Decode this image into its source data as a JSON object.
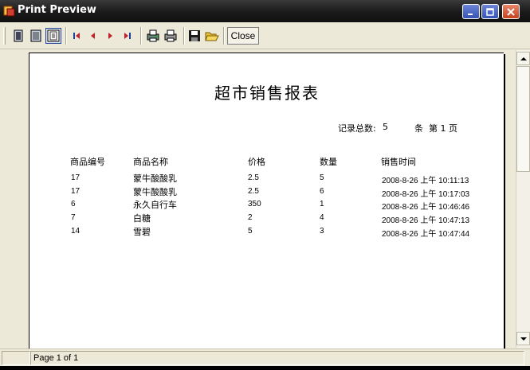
{
  "window": {
    "title": "Print Preview"
  },
  "toolbar": {
    "close_label": "Close"
  },
  "report": {
    "title": "超市销售报表",
    "summary_label": "记录总数:",
    "summary_count": "5",
    "summary_unit": "条",
    "page_label": "第 1 页",
    "columns": [
      "商品编号",
      "商品名称",
      "价格",
      "数量",
      "销售时间"
    ],
    "rows": [
      [
        "17",
        "蒙牛酸酸乳",
        "2.5",
        "5",
        "2008-8-26 上午 10:11:13"
      ],
      [
        "17",
        "蒙牛酸酸乳",
        "2.5",
        "6",
        "2008-8-26 上午 10:17:03"
      ],
      [
        "6",
        "永久自行车",
        "350",
        "1",
        "2008-8-26 上午 10:46:46"
      ],
      [
        "7",
        "白糖",
        "2",
        "4",
        "2008-8-26 上午 10:47:13"
      ],
      [
        "14",
        "雪碧",
        "5",
        "3",
        "2008-8-26 上午 10:47:44"
      ]
    ]
  },
  "status": {
    "page_text": "Page 1 of 1"
  },
  "colors": {
    "title_bar": "#1a1a1a",
    "page_bg": "#ffffff",
    "chrome": "#ece9d8"
  }
}
